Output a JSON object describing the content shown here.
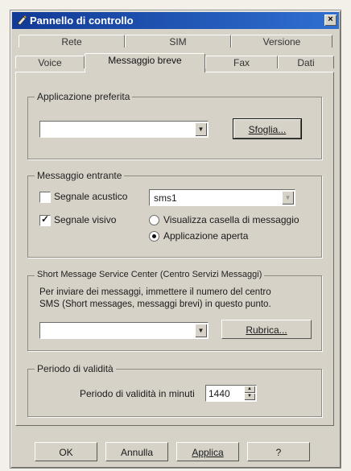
{
  "window": {
    "title": "Pannello di controllo",
    "close_label": "×"
  },
  "tabs": {
    "back_row": [
      "Rete",
      "SIM",
      "Versione"
    ],
    "front_row": [
      "Voice",
      "Messaggio breve",
      "Fax",
      "Dati"
    ],
    "active": "Messaggio breve"
  },
  "applicazione": {
    "legend": "Applicazione preferita",
    "combo_value": "",
    "browse_button": "Sfoglia..."
  },
  "messaggio_entrante": {
    "legend": "Messaggio entrante",
    "acoustic_label": "Segnale acustico",
    "acoustic_checked": false,
    "sound_combo_value": "sms1",
    "visual_label": "Segnale visivo",
    "visual_checked": true,
    "radio_options": [
      "Visualizza casella di messaggio",
      "Applicazione aperta"
    ],
    "radio_selected": "Applicazione aperta"
  },
  "smsc": {
    "legend": "Short Message Service Center (Centro Servizi Messaggi)",
    "instructions_line1": "Per inviare dei messaggi, immettere il numero del centro",
    "instructions_line2": "SMS (Short messages, messaggi brevi) in questo punto.",
    "combo_value": "",
    "rubrica_button": "Rubrica..."
  },
  "validita": {
    "legend": "Periodo di validità",
    "label": "Periodo di validità in minuti",
    "value": "1440"
  },
  "footer": {
    "ok": "OK",
    "annulla": "Annulla",
    "applica": "Applica",
    "help": "?"
  },
  "colors": {
    "titlebar_start": "#123a96",
    "titlebar_end": "#2f6fd0",
    "dialog_bg": "#d6d2c8"
  }
}
